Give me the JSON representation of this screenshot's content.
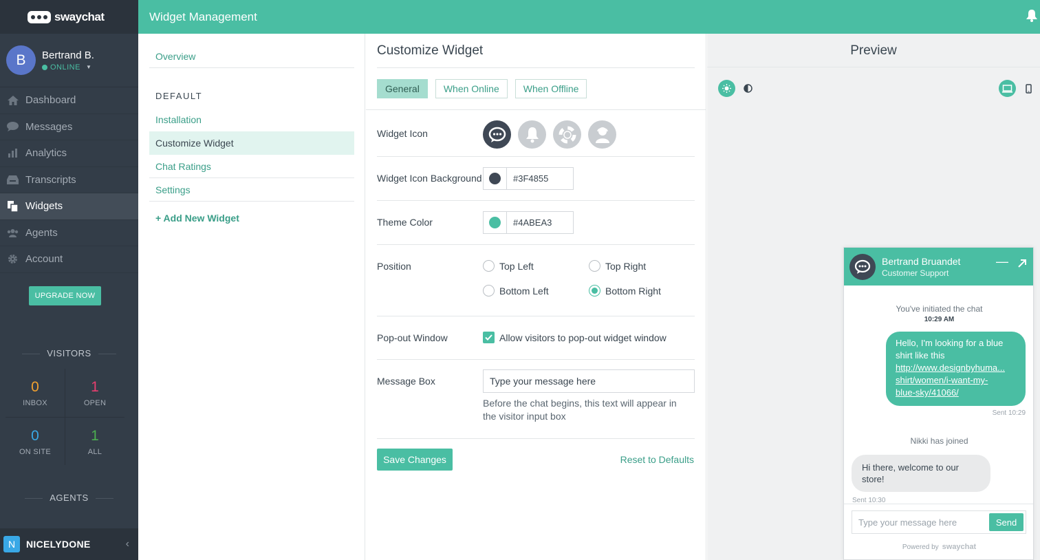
{
  "app": {
    "logo_text": "swaychat",
    "page_title": "Widget Management"
  },
  "user": {
    "initial": "B",
    "name": "Bertrand B.",
    "status": "ONLINE"
  },
  "nav": [
    {
      "label": "Dashboard",
      "icon": "home-icon"
    },
    {
      "label": "Messages",
      "icon": "chat-bubble-icon"
    },
    {
      "label": "Analytics",
      "icon": "bar-chart-icon"
    },
    {
      "label": "Transcripts",
      "icon": "inbox-icon"
    },
    {
      "label": "Widgets",
      "icon": "copy-icon",
      "active": true
    },
    {
      "label": "Agents",
      "icon": "users-icon"
    },
    {
      "label": "Account",
      "icon": "gear-icon"
    }
  ],
  "upgrade_label": "UPGRADE NOW",
  "visitors": {
    "title": "VISITORS",
    "stats": [
      {
        "value": "0",
        "label": "INBOX",
        "color": "#f0a030"
      },
      {
        "value": "1",
        "label": "OPEN",
        "color": "#e83f6f"
      },
      {
        "value": "0",
        "label": "ON SITE",
        "color": "#39a8e6"
      },
      {
        "value": "1",
        "label": "ALL",
        "color": "#4caf50"
      }
    ]
  },
  "agents_title": "AGENTS",
  "team": {
    "initial": "N",
    "name": "NICELYDONE"
  },
  "widget_nav": {
    "overview": "Overview",
    "section": "DEFAULT",
    "items": [
      "Installation",
      "Customize Widget",
      "Chat Ratings",
      "Settings"
    ],
    "active": "Customize Widget",
    "add_new": "+ Add New Widget"
  },
  "form": {
    "title": "Customize Widget",
    "tabs": [
      "General",
      "When Online",
      "When Offline"
    ],
    "active_tab": "General",
    "widget_icon_label": "Widget Icon",
    "icon_options": [
      "chat-bubble-icon",
      "bell-icon",
      "lifebuoy-icon",
      "agent-icon"
    ],
    "icon_bg_label": "Widget Icon Background",
    "icon_bg_value": "#3F4855",
    "theme_label": "Theme Color",
    "theme_value": "#4ABEA3",
    "position_label": "Position",
    "positions": [
      "Top Left",
      "Top Right",
      "Bottom Left",
      "Bottom Right"
    ],
    "position_selected": "Bottom Right",
    "popout_label": "Pop-out Window",
    "popout_text": "Allow visitors to pop-out widget window",
    "popout_checked": true,
    "message_box_label": "Message Box",
    "message_box_placeholder": "Type your message here",
    "message_box_help": "Before the chat begins, this text will appear in the visitor input box",
    "save_label": "Save Changes",
    "reset_label": "Reset to Defaults"
  },
  "preview": {
    "title": "Preview",
    "chat": {
      "agent_name": "Bertrand Bruandet",
      "agent_role": "Customer Support",
      "system_start": "You've initiated the chat",
      "system_start_time": "10:29 AM",
      "visitor_msg_text": "Hello, I'm looking for a blue shirt like this",
      "visitor_msg_link_1": "http://www.designbyhuma...",
      "visitor_msg_link_2": "shirt/women/i-want-my-",
      "visitor_msg_link_3": "blue-sky/41066/",
      "visitor_sent": "Sent 10:29",
      "system_join": "Nikki has joined",
      "agent_msg": "Hi there, welcome to our store!",
      "agent_sent": "Sent 10:30",
      "input_placeholder": "Type your message here",
      "send_label": "Send",
      "powered_by": "Powered by",
      "powered_logo": "swaychat"
    }
  },
  "colors": {
    "accent": "#4abea3",
    "sidebar": "#333d48",
    "icon_bg": "#3f4855"
  }
}
